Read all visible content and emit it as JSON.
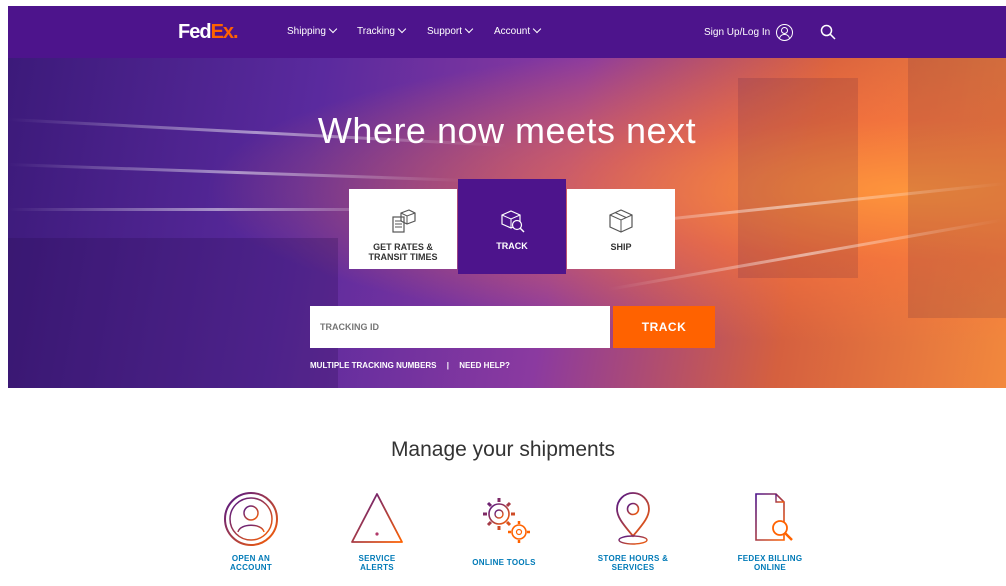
{
  "nav": {
    "logo_fed": "Fed",
    "logo_ex": "Ex",
    "logo_dot": ".",
    "items": [
      {
        "label": "Shipping"
      },
      {
        "label": "Tracking"
      },
      {
        "label": "Support"
      },
      {
        "label": "Account"
      }
    ],
    "signin_label": "Sign Up/Log In"
  },
  "hero": {
    "title": "Where now meets next",
    "tabs": [
      {
        "label_line1": "GET RATES &",
        "label_line2": "TRANSIT TIMES",
        "icon": "rates-calculator-icon"
      },
      {
        "label_line1": "TRACK",
        "label_line2": "",
        "icon": "track-package-icon",
        "active": true
      },
      {
        "label_line1": "SHIP",
        "label_line2": "",
        "icon": "ship-box-icon"
      }
    ],
    "tracking_placeholder": "TRACKING ID",
    "track_button": "TRACK",
    "link_multiple": "MULTIPLE TRACKING NUMBERS",
    "link_separator": "|",
    "link_help": "NEED HELP?"
  },
  "manage": {
    "title": "Manage your shipments",
    "items": [
      {
        "line1": "OPEN AN",
        "line2": "ACCOUNT",
        "icon": "account-user-icon"
      },
      {
        "line1": "SERVICE",
        "line2": "ALERTS",
        "icon": "alert-warning-icon"
      },
      {
        "line1": "ONLINE TOOLS",
        "line2": "",
        "icon": "gears-icon"
      },
      {
        "line1": "STORE HOURS &",
        "line2": "SERVICES",
        "icon": "location-pin-icon"
      },
      {
        "line1": "FEDEX BILLING",
        "line2": "ONLINE",
        "icon": "billing-document-icon"
      }
    ]
  },
  "colors": {
    "purple": "#4d148c",
    "orange": "#ff6200",
    "link_blue": "#007ab7"
  }
}
